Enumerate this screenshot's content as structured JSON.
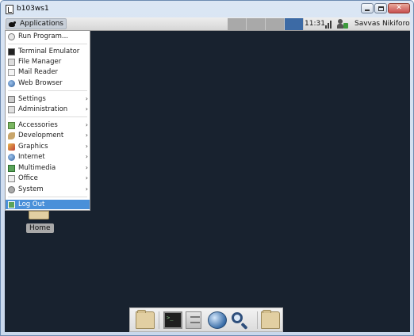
{
  "window": {
    "title": "b103ws1",
    "icon": "vnc-viewer-icon",
    "controls": [
      "minimize-icon",
      "maximize-icon",
      "close-icon"
    ]
  },
  "panel": {
    "applications_label": "Applications",
    "workspaces": 4,
    "active_workspace": 4,
    "clock": "11:31",
    "username": "Savvas Nikiforou"
  },
  "apps_menu": {
    "items": [
      {
        "label": "Run Program...",
        "icon": "run-icon",
        "submenu": false
      },
      {
        "label": "Terminal Emulator",
        "icon": "terminal-icon",
        "submenu": false
      },
      {
        "label": "File Manager",
        "icon": "file-manager-icon",
        "submenu": false
      },
      {
        "label": "Mail Reader",
        "icon": "mail-icon",
        "submenu": false
      },
      {
        "label": "Web Browser",
        "icon": "web-browser-icon",
        "submenu": false
      },
      {
        "label": "Settings",
        "icon": "settings-icon",
        "submenu": true
      },
      {
        "label": "Administration",
        "icon": "administration-icon",
        "submenu": true
      },
      {
        "label": "Accessories",
        "icon": "accessories-icon",
        "submenu": true
      },
      {
        "label": "Development",
        "icon": "development-icon",
        "submenu": true
      },
      {
        "label": "Graphics",
        "icon": "graphics-icon",
        "submenu": true
      },
      {
        "label": "Internet",
        "icon": "internet-icon",
        "submenu": true
      },
      {
        "label": "Multimedia",
        "icon": "multimedia-icon",
        "submenu": true
      },
      {
        "label": "Office",
        "icon": "office-icon",
        "submenu": true
      },
      {
        "label": "System",
        "icon": "system-icon",
        "submenu": true
      },
      {
        "label": "Log Out",
        "icon": "logout-icon",
        "submenu": false,
        "selected": true
      }
    ],
    "submenu_arrow": "›"
  },
  "desktop": {
    "home_label": "Home"
  },
  "dock": {
    "items": [
      "folder-icon",
      "terminal-icon",
      "file-cabinet-icon",
      "web-browser-icon",
      "search-icon",
      "folder-icon"
    ]
  },
  "colors": {
    "desktop_background": "#18222f",
    "selection": "#4a90d9",
    "active_workspace": "#3c6aa5"
  }
}
